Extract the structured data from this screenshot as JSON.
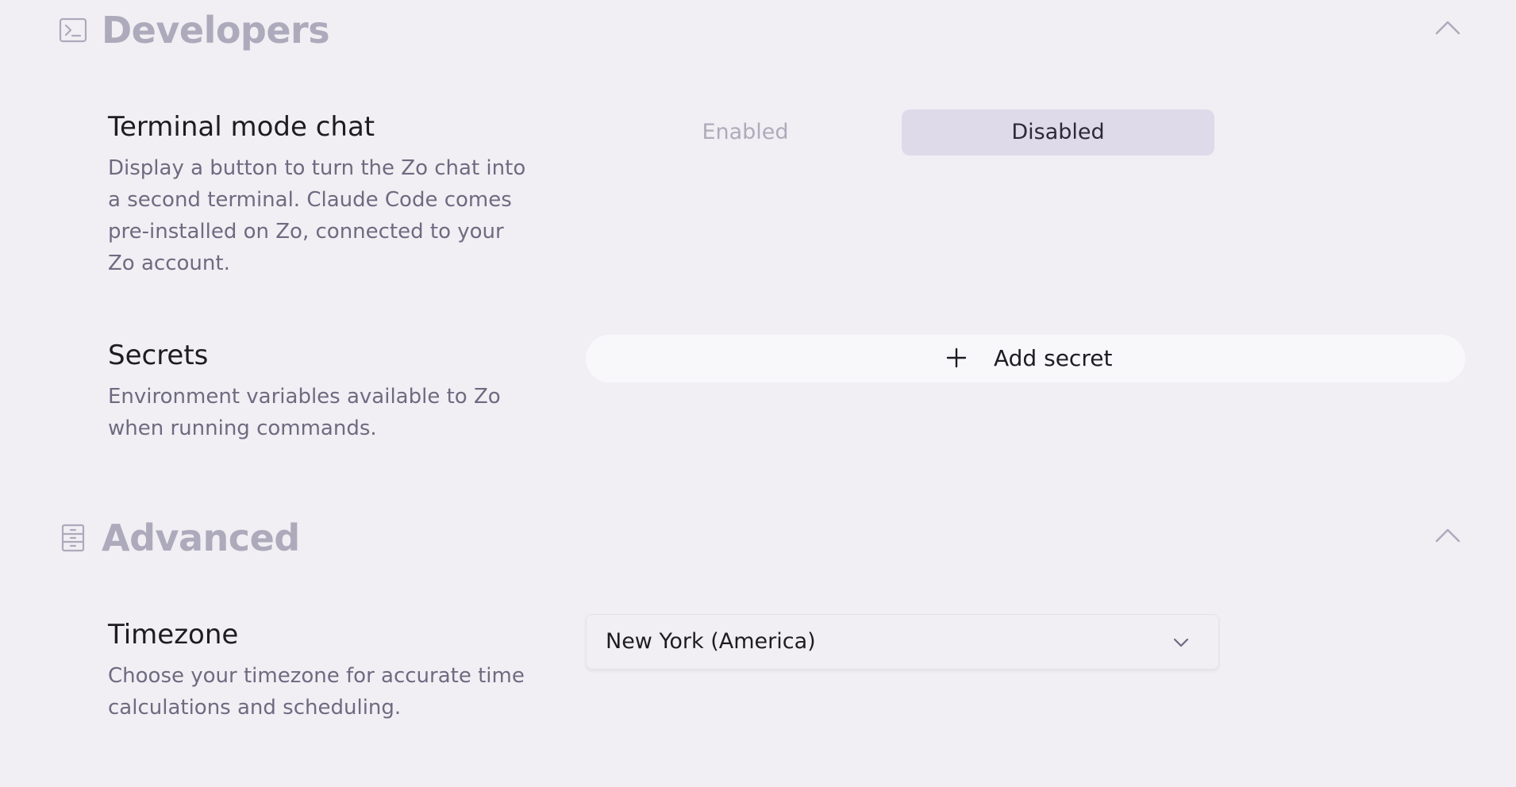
{
  "sections": {
    "developers": {
      "title": "Developers",
      "icon": "terminal-icon",
      "collapse_icon": "chevron-up-icon",
      "terminal_mode": {
        "title": "Terminal mode chat",
        "description": "Display a button to turn the Zo chat into a second terminal. Claude Code comes pre-installed on Zo, connected to your Zo account.",
        "options": [
          "Enabled",
          "Disabled"
        ],
        "selected": "Disabled"
      },
      "secrets": {
        "title": "Secrets",
        "description": "Environment variables available to Zo when running commands.",
        "add_label": "Add secret",
        "add_icon": "plus-icon"
      }
    },
    "advanced": {
      "title": "Advanced",
      "icon": "cabinet-icon",
      "collapse_icon": "chevron-up-icon",
      "timezone": {
        "title": "Timezone",
        "description": "Choose your timezone for accurate time calculations and scheduling.",
        "selected": "New York (America)",
        "dropdown_icon": "chevron-down-icon"
      }
    }
  },
  "colors": {
    "background": "#f1eff4",
    "section_title": "#adaabb",
    "selected_segment": "#dedaea",
    "description": "#6e6b80"
  }
}
